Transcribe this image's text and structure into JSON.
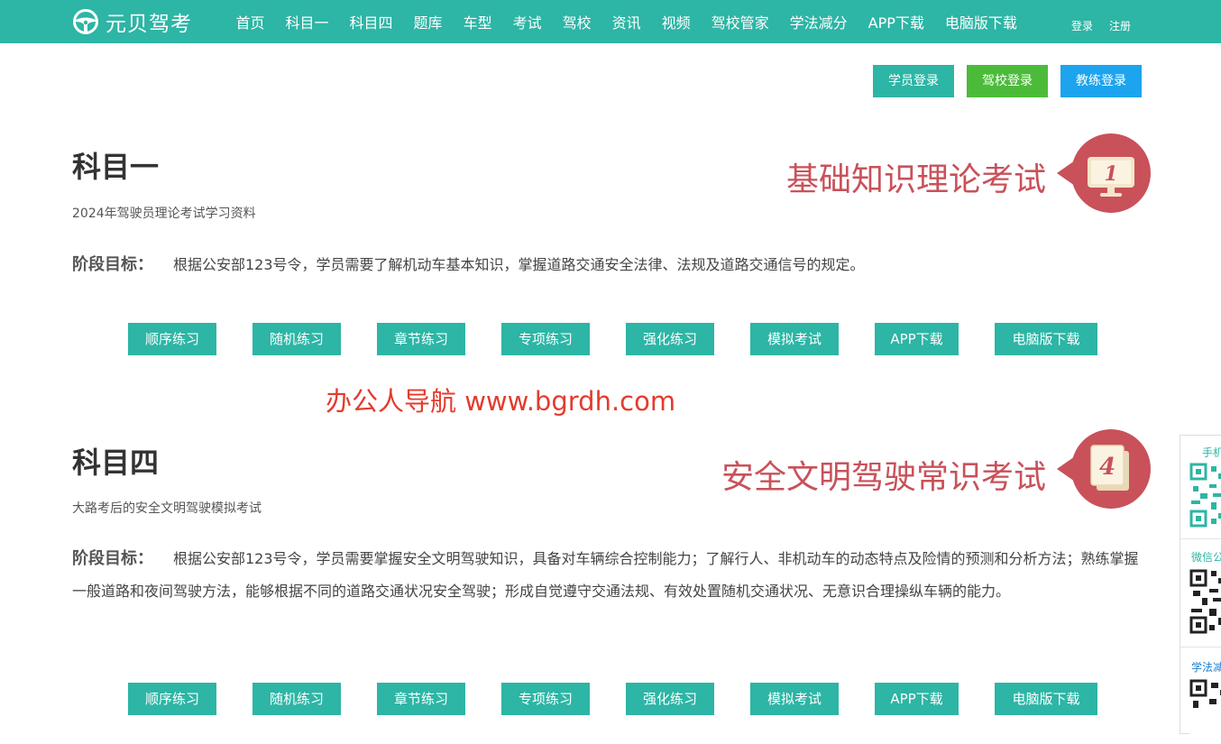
{
  "header": {
    "brand": "元贝驾考",
    "nav": [
      "首页",
      "科目一",
      "科目四",
      "题库",
      "车型",
      "考试",
      "驾校",
      "资讯",
      "视频",
      "驾校管家",
      "学法减分",
      "APP下载",
      "电脑版下载"
    ],
    "login": "登录",
    "register": "注册"
  },
  "logins": {
    "student": "学员登录",
    "school": "驾校登录",
    "coach": "教练登录"
  },
  "subject1": {
    "title": "科目一",
    "subtitle": "2024年驾驶员理论考试学习资料",
    "goal_label": "阶段目标：",
    "goal_text": "根据公安部123号令，学员需要了解机动车基本知识，掌握道路交通安全法律、法规及道路交通信号的规定。",
    "slogan": "基础知识理论考试",
    "badge_number": "1",
    "buttons": [
      "顺序练习",
      "随机练习",
      "章节练习",
      "专项练习",
      "强化练习",
      "模拟考试",
      "APP下载",
      "电脑版下载"
    ]
  },
  "watermark": "办公人导航 www.bgrdh.com",
  "subject4": {
    "title": "科目四",
    "subtitle": "大路考后的安全文明驾驶模拟考试",
    "goal_label": "阶段目标：",
    "goal_text": "根据公安部123号令，学员需要掌握安全文明驾驶知识，具备对车辆综合控制能力；了解行人、非机动车的动态特点及险情的预测和分析方法；熟练掌握一般道路和夜间驾驶方法，能够根据不同的道路交通状况安全驾驶；形成自觉遵守交通法规、有效处置随机交通状况、无意识合理操纵车辆的能力。",
    "slogan": "安全文明驾驶常识考试",
    "badge_number": "4",
    "buttons": [
      "顺序练习",
      "随机练习",
      "章节练习",
      "专项练习",
      "强化练习",
      "模拟考试",
      "APP下载",
      "电脑版下载"
    ]
  },
  "side_panel": {
    "label1": "手机",
    "label2": "微信公",
    "label3": "学法减"
  },
  "colors": {
    "primary": "#2db5a5",
    "green": "#4cbb3a",
    "blue": "#1ca4ee",
    "accent_red": "#c9515a",
    "watermark_red": "#e33b2e"
  },
  "icons": {
    "logo": "steering-wheel-icon",
    "badge1": "monitor-icon",
    "badge4": "book-icon"
  }
}
